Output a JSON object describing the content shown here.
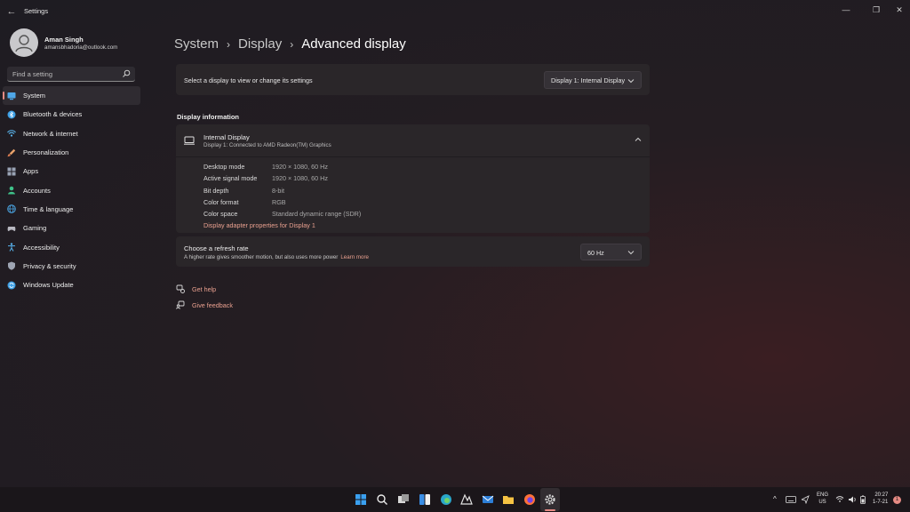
{
  "window": {
    "title": "Settings",
    "back_glyph": "←",
    "minimize_glyph": "—",
    "restore_glyph": "❐",
    "close_glyph": "✕"
  },
  "profile": {
    "name": "Aman Singh",
    "email": "amansbhadoria@outlook.com"
  },
  "search": {
    "placeholder": "Find a setting",
    "icon": "search-icon"
  },
  "sidebar": {
    "items": [
      {
        "label": "System",
        "icon": "system-icon",
        "color": "#4fa7e8",
        "active": true
      },
      {
        "label": "Bluetooth & devices",
        "icon": "bluetooth-icon",
        "color": "#3ea0e6"
      },
      {
        "label": "Network & internet",
        "icon": "wifi-icon",
        "color": "#5bb7f0"
      },
      {
        "label": "Personalization",
        "icon": "brush-icon",
        "color": "#e8a26a"
      },
      {
        "label": "Apps",
        "icon": "apps-icon",
        "color": "#9aa3b5"
      },
      {
        "label": "Accounts",
        "icon": "accounts-icon",
        "color": "#3fc28a"
      },
      {
        "label": "Time & language",
        "icon": "globe-clock-icon",
        "color": "#4aa3e0"
      },
      {
        "label": "Gaming",
        "icon": "gaming-icon",
        "color": "#b9b9c2"
      },
      {
        "label": "Accessibility",
        "icon": "accessibility-icon",
        "color": "#58b4f0"
      },
      {
        "label": "Privacy & security",
        "icon": "shield-icon",
        "color": "#9ea5b3"
      },
      {
        "label": "Windows Update",
        "icon": "update-icon",
        "color": "#3fa0e5"
      }
    ]
  },
  "breadcrumb": {
    "items": [
      "System",
      "Display",
      "Advanced display"
    ],
    "separator": "›"
  },
  "display_select": {
    "label": "Select a display to view or change its settings",
    "value": "Display 1: Internal Display"
  },
  "display_info": {
    "section_title": "Display information",
    "name": "Internal Display",
    "subtitle": "Display 1: Connected to AMD Radeon(TM) Graphics",
    "rows": [
      {
        "key": "Desktop mode",
        "value": "1920 × 1080, 60 Hz"
      },
      {
        "key": "Active signal mode",
        "value": "1920 × 1080, 60 Hz"
      },
      {
        "key": "Bit depth",
        "value": "8-bit"
      },
      {
        "key": "Color format",
        "value": "RGB"
      },
      {
        "key": "Color space",
        "value": "Standard dynamic range (SDR)"
      }
    ],
    "adapter_link": "Display adapter properties for Display 1"
  },
  "refresh": {
    "title": "Choose a refresh rate",
    "subtitle": "A higher rate gives smoother motion, but also uses more power",
    "learn_more": "Learn more",
    "value": "60 Hz"
  },
  "help": {
    "get_help": "Get help",
    "give_feedback": "Give feedback"
  },
  "taskbar": {
    "apps": [
      "start-icon",
      "search-icon",
      "task-view-icon",
      "widgets-icon",
      "edge-icon",
      "photos-icon",
      "mail-icon",
      "file-explorer-icon",
      "firefox-icon",
      "settings-icon"
    ],
    "language": "ENG",
    "region": "US",
    "time": "20:27",
    "date": "1-7-21",
    "notification_count": "1",
    "accent": "#e58a83"
  }
}
